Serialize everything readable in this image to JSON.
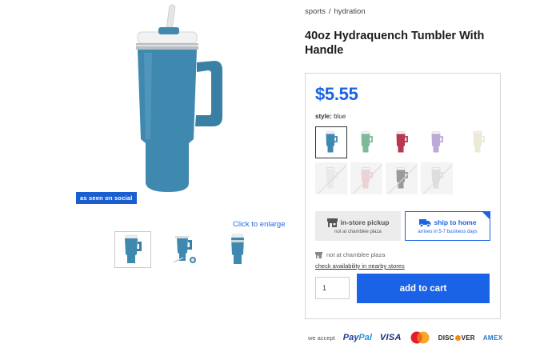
{
  "breadcrumb": {
    "category": "sports",
    "separator": "/",
    "subcategory": "hydration"
  },
  "product": {
    "title": "40oz Hydraquench Tumbler With Handle",
    "price": "$5.55",
    "style_label": "style:",
    "style_value": "blue"
  },
  "gallery": {
    "badge": "as seen on social",
    "enlarge_link": "Click to enlarge",
    "thumbnails": [
      "tumbler-front",
      "tumbler-with-straw-parts",
      "tumbler-side"
    ]
  },
  "swatches": [
    {
      "name": "blue",
      "color": "#3f88b0",
      "selected": true,
      "available": true
    },
    {
      "name": "sage",
      "color": "#7fb89a",
      "selected": false,
      "available": true
    },
    {
      "name": "berry",
      "color": "#b8364e",
      "selected": false,
      "available": true
    },
    {
      "name": "lavender",
      "color": "#bba9d6",
      "selected": false,
      "available": true
    },
    {
      "name": "cream",
      "color": "#ecead4",
      "selected": false,
      "available": true
    },
    {
      "name": "white",
      "color": "#e9e9e9",
      "selected": false,
      "available": false
    },
    {
      "name": "pink",
      "color": "#ecd2d2",
      "selected": false,
      "available": false
    },
    {
      "name": "gray",
      "color": "#9a9a9a",
      "selected": false,
      "available": false
    },
    {
      "name": "light-gray",
      "color": "#dedede",
      "selected": false,
      "available": false
    }
  ],
  "shipping": {
    "pickup": {
      "title": "in-store pickup",
      "sub": "not at chamblee plaza"
    },
    "home": {
      "title": "ship to home",
      "sub": "arrives in 5-7 business days"
    }
  },
  "store": {
    "status": "not at chamblee plaza",
    "check_link": "check availability in nearby stores"
  },
  "cart": {
    "quantity": "1",
    "add_label": "add to cart"
  },
  "payments": {
    "label": "we accept",
    "paypal_a": "Pay",
    "paypal_b": "Pal",
    "visa": "VISA",
    "mastercard": "MasterCard",
    "discover_a": "DISC",
    "discover_b": "VER",
    "amex": "AMEX"
  },
  "colors": {
    "accent": "#1a63e6",
    "tumbler_blue": "#3f88b0"
  }
}
